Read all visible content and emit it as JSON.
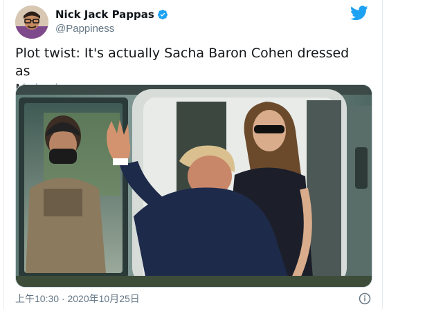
{
  "tweet": {
    "author": {
      "display_name": "Nick Jack Pappas",
      "handle": "@Pappiness",
      "verified": true
    },
    "text": "Plot twist: It's actually Sacha Baron Cohen dressed as\nMelania.",
    "timestamp": "上午10:30 · 2020年10月25日"
  },
  "icons": {
    "verified": "verified-badge-icon",
    "brand": "twitter-bird-icon",
    "info": "info-icon"
  },
  "colors": {
    "accent": "#1da1f2",
    "secondary_text": "#657786"
  }
}
